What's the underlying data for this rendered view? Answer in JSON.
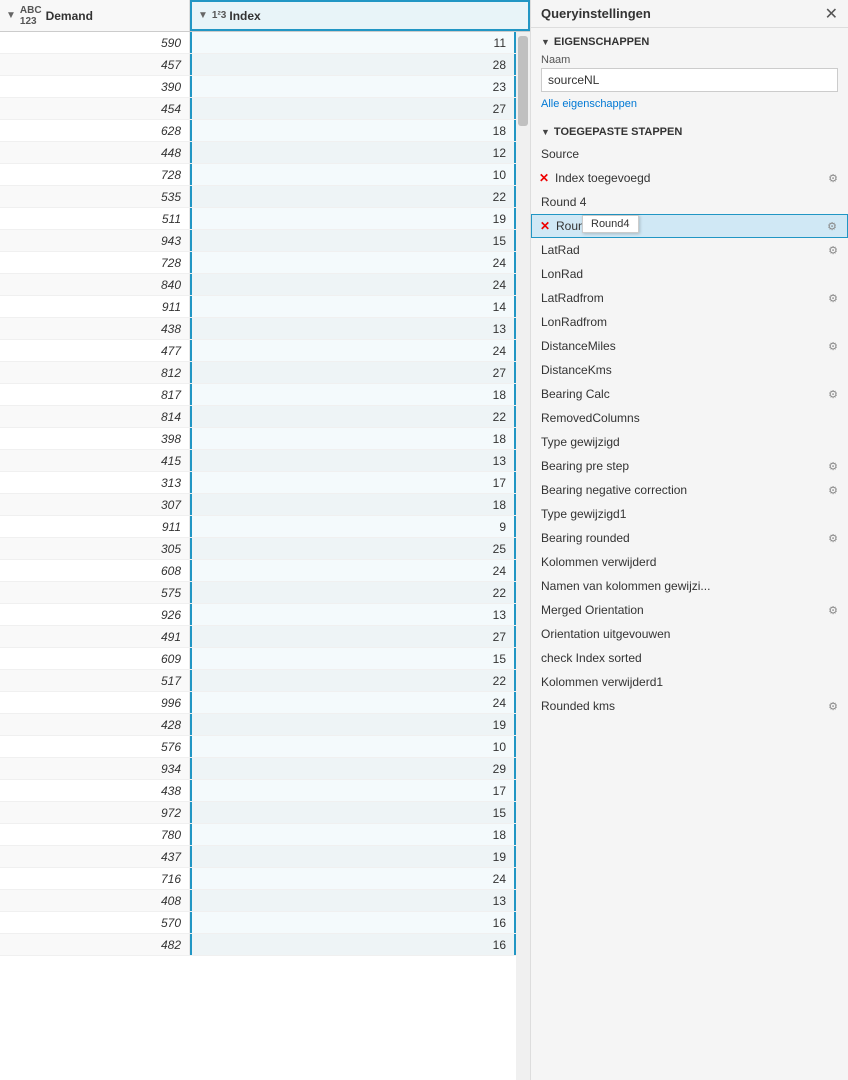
{
  "panel": {
    "title": "Queryinstellingen",
    "close_label": "✕",
    "sections": {
      "eigenschappen": {
        "label": "EIGENSCHAPPEN",
        "naam_label": "Naam",
        "naam_value": "sourceNL",
        "alle_prop_link": "Alle eigenschappen"
      },
      "stappen": {
        "label": "TOEGEPASTE STAPPEN"
      }
    },
    "steps": [
      {
        "id": "Source",
        "label": "Source",
        "has_x": false,
        "has_gear": false,
        "active": false,
        "tooltip": ""
      },
      {
        "id": "Index toegevoegd",
        "label": "Index toegevoegd",
        "has_x": true,
        "has_gear": true,
        "active": false,
        "tooltip": ""
      },
      {
        "id": "Round 4",
        "label": "Round 4",
        "has_x": false,
        "has_gear": false,
        "active": false,
        "tooltip": ""
      },
      {
        "id": "Round4",
        "label": "Round4",
        "has_x": true,
        "has_gear": true,
        "active": true,
        "tooltip": "Round4"
      },
      {
        "id": "LatRad",
        "label": "LatRad",
        "has_x": false,
        "has_gear": true,
        "active": false,
        "tooltip": ""
      },
      {
        "id": "LonRad",
        "label": "LonRad",
        "has_x": false,
        "has_gear": false,
        "active": false,
        "tooltip": ""
      },
      {
        "id": "LatRadfrom",
        "label": "LatRadfrom",
        "has_x": false,
        "has_gear": true,
        "active": false,
        "tooltip": ""
      },
      {
        "id": "LonRadfrom",
        "label": "LonRadfrom",
        "has_x": false,
        "has_gear": false,
        "active": false,
        "tooltip": ""
      },
      {
        "id": "DistanceMiles",
        "label": "DistanceMiles",
        "has_x": false,
        "has_gear": true,
        "active": false,
        "tooltip": ""
      },
      {
        "id": "DistanceKms",
        "label": "DistanceKms",
        "has_x": false,
        "has_gear": false,
        "active": false,
        "tooltip": ""
      },
      {
        "id": "Bearing Calc",
        "label": "Bearing Calc",
        "has_x": false,
        "has_gear": true,
        "active": false,
        "tooltip": ""
      },
      {
        "id": "RemovedColumns",
        "label": "RemovedColumns",
        "has_x": false,
        "has_gear": false,
        "active": false,
        "tooltip": ""
      },
      {
        "id": "Type gewijzigd",
        "label": "Type gewijzigd",
        "has_x": false,
        "has_gear": false,
        "active": false,
        "tooltip": ""
      },
      {
        "id": "Bearing pre step",
        "label": "Bearing pre step",
        "has_x": false,
        "has_gear": true,
        "active": false,
        "tooltip": ""
      },
      {
        "id": "Bearing negative correction",
        "label": "Bearing negative correction",
        "has_x": false,
        "has_gear": true,
        "active": false,
        "tooltip": ""
      },
      {
        "id": "Type gewijzigd1",
        "label": "Type gewijzigd1",
        "has_x": false,
        "has_gear": false,
        "active": false,
        "tooltip": ""
      },
      {
        "id": "Bearing rounded",
        "label": "Bearing rounded",
        "has_x": false,
        "has_gear": true,
        "active": false,
        "tooltip": ""
      },
      {
        "id": "Kolommen verwijderd",
        "label": "Kolommen verwijderd",
        "has_x": false,
        "has_gear": false,
        "active": false,
        "tooltip": ""
      },
      {
        "id": "Namen van kolommen gewijzi...",
        "label": "Namen van kolommen gewijzi...",
        "has_x": false,
        "has_gear": false,
        "active": false,
        "tooltip": ""
      },
      {
        "id": "Merged Orientation",
        "label": "Merged Orientation",
        "has_x": false,
        "has_gear": true,
        "active": false,
        "tooltip": ""
      },
      {
        "id": "Orientation uitgevouwen",
        "label": "Orientation uitgevouwen",
        "has_x": false,
        "has_gear": false,
        "active": false,
        "tooltip": ""
      },
      {
        "id": "check Index sorted",
        "label": "check Index sorted",
        "has_x": false,
        "has_gear": false,
        "active": false,
        "tooltip": ""
      },
      {
        "id": "Kolommen verwijderd1",
        "label": "Kolommen verwijderd1",
        "has_x": false,
        "has_gear": false,
        "active": false,
        "tooltip": ""
      },
      {
        "id": "Rounded kms",
        "label": "Rounded kms",
        "has_x": false,
        "has_gear": true,
        "active": false,
        "tooltip": ""
      }
    ]
  },
  "table": {
    "col_demand_label": "Demand",
    "col_index_label": "Index",
    "rows": [
      {
        "demand": 590,
        "index": 11
      },
      {
        "demand": 457,
        "index": 28
      },
      {
        "demand": 390,
        "index": 23
      },
      {
        "demand": 454,
        "index": 27
      },
      {
        "demand": 628,
        "index": 18
      },
      {
        "demand": 448,
        "index": 12
      },
      {
        "demand": 728,
        "index": 10
      },
      {
        "demand": 535,
        "index": 22
      },
      {
        "demand": 511,
        "index": 19
      },
      {
        "demand": 943,
        "index": 15
      },
      {
        "demand": 728,
        "index": 24
      },
      {
        "demand": 840,
        "index": 24
      },
      {
        "demand": 911,
        "index": 14
      },
      {
        "demand": 438,
        "index": 13
      },
      {
        "demand": 477,
        "index": 24
      },
      {
        "demand": 812,
        "index": 27
      },
      {
        "demand": 817,
        "index": 18
      },
      {
        "demand": 814,
        "index": 22
      },
      {
        "demand": 398,
        "index": 18
      },
      {
        "demand": 415,
        "index": 13
      },
      {
        "demand": 313,
        "index": 17
      },
      {
        "demand": 307,
        "index": 18
      },
      {
        "demand": 911,
        "index": 9
      },
      {
        "demand": 305,
        "index": 25
      },
      {
        "demand": 608,
        "index": 24
      },
      {
        "demand": 575,
        "index": 22
      },
      {
        "demand": 926,
        "index": 13
      },
      {
        "demand": 491,
        "index": 27
      },
      {
        "demand": 609,
        "index": 15
      },
      {
        "demand": 517,
        "index": 22
      },
      {
        "demand": 996,
        "index": 24
      },
      {
        "demand": 428,
        "index": 19
      },
      {
        "demand": 576,
        "index": 10
      },
      {
        "demand": 934,
        "index": 29
      },
      {
        "demand": 438,
        "index": 17
      },
      {
        "demand": 972,
        "index": 15
      },
      {
        "demand": 780,
        "index": 18
      },
      {
        "demand": 437,
        "index": 19
      },
      {
        "demand": 716,
        "index": 24
      },
      {
        "demand": 408,
        "index": 13
      },
      {
        "demand": 570,
        "index": 16
      },
      {
        "demand": 482,
        "index": 16
      }
    ]
  }
}
